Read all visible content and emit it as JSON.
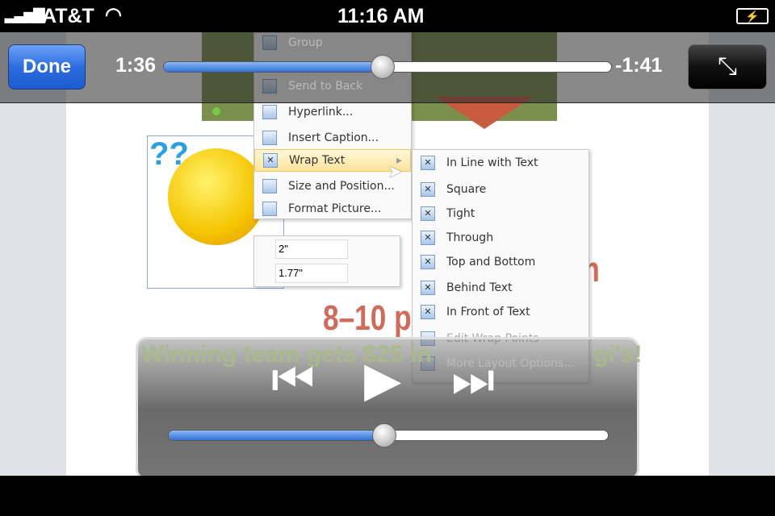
{
  "status": {
    "carrier": "AT&T",
    "time": "11:16 AM",
    "signal_icon": "signal-bars-icon",
    "wifi_icon": "wifi-icon",
    "battery_icon": "battery-charging-icon"
  },
  "player": {
    "done_label": "Done",
    "elapsed": "1:36",
    "remaining": "-1:41",
    "progress_percent": 49,
    "volume_percent": 49,
    "fullscreen_icon": "exit-fullscreen-icon",
    "accent": "#2f72d8"
  },
  "document": {
    "line1": "5–6 pm",
    "line1_visible": "om",
    "line2": "8–10 p",
    "line3": "Winning team gets $25 in",
    "line3_end": "gi's!"
  },
  "context_menu": {
    "items": [
      "Group",
      "Send to Back",
      "Hyperlink...",
      "Insert Caption...",
      "Wrap Text",
      "Size and Position...",
      "Format Picture..."
    ]
  },
  "submenu": {
    "items": [
      "In Line with Text",
      "Square",
      "Tight",
      "Through",
      "Top and Bottom",
      "Behind Text",
      "In Front of Text",
      "Edit Wrap Points",
      "More Layout Options..."
    ]
  },
  "size_toolbar": {
    "height": "2\"",
    "width": "1.77\""
  }
}
